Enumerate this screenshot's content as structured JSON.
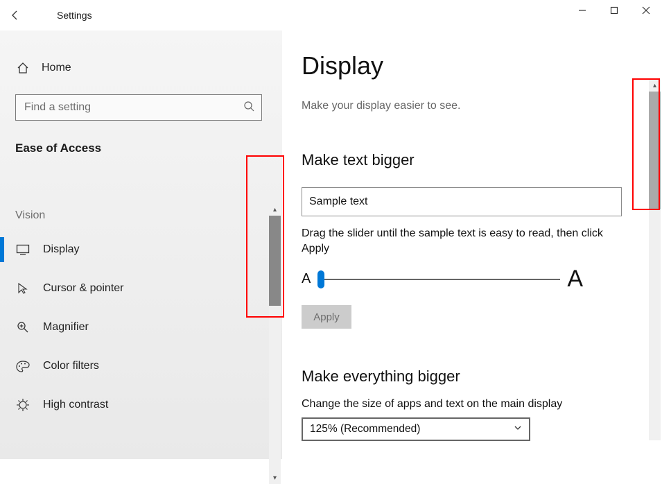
{
  "titlebar": {
    "app_title": "Settings"
  },
  "sidebar": {
    "home_label": "Home",
    "search_placeholder": "Find a setting",
    "category": "Ease of Access",
    "vision_label": "Vision",
    "items": [
      {
        "label": "Display",
        "icon": "monitor-icon",
        "selected": true
      },
      {
        "label": "Cursor & pointer",
        "icon": "cursor-icon",
        "selected": false
      },
      {
        "label": "Magnifier",
        "icon": "magnifier-icon",
        "selected": false
      },
      {
        "label": "Color filters",
        "icon": "palette-icon",
        "selected": false
      },
      {
        "label": "High contrast",
        "icon": "contrast-icon",
        "selected": false
      }
    ]
  },
  "content": {
    "title": "Display",
    "subtitle": "Make your display easier to see.",
    "section1_header": "Make text bigger",
    "sample_text": "Sample text",
    "slider_instruction": "Drag the slider until the sample text is easy to read, then click Apply",
    "slider_small_label": "A",
    "slider_big_label": "A",
    "apply_label": "Apply",
    "section2_header": "Make everything bigger",
    "size_label": "Change the size of apps and text on the main display",
    "dropdown_value": "125% (Recommended)"
  }
}
